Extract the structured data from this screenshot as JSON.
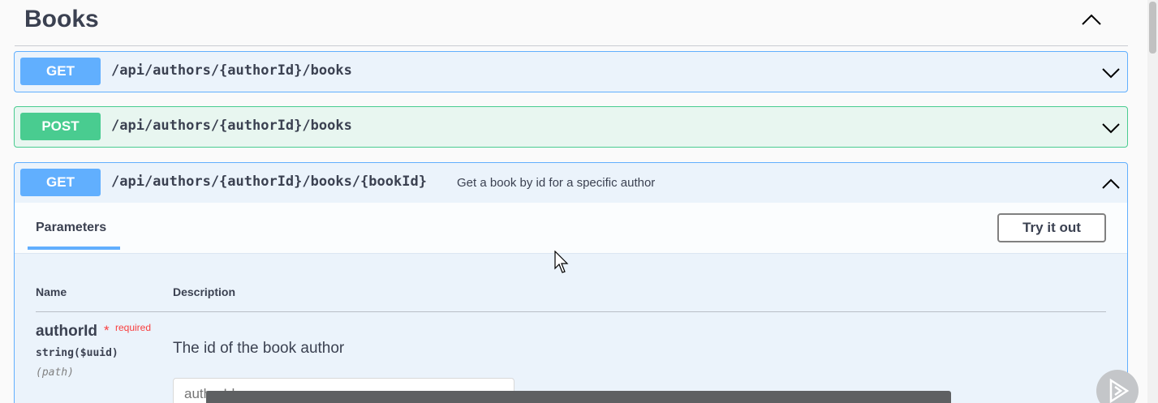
{
  "section": {
    "title": "Books"
  },
  "operations": [
    {
      "method": "GET",
      "path": "/api/authors/{authorId}/books"
    },
    {
      "method": "POST",
      "path": "/api/authors/{authorId}/books"
    },
    {
      "method": "GET",
      "path": "/api/authors/{authorId}/books/{bookId}",
      "summary": "Get a book by id for a specific author"
    }
  ],
  "expanded": {
    "tab_label": "Parameters",
    "try_button": "Try it out",
    "columns": {
      "name": "Name",
      "description": "Description"
    },
    "param": {
      "name": "authorId",
      "required_star": "*",
      "required_label": "required",
      "type": "string($uuid)",
      "in": "(path)",
      "description": "The id of the book author",
      "placeholder": "authorId"
    }
  },
  "colors": {
    "get": "#61affe",
    "post": "#49cc90",
    "required": "#f93e3e"
  },
  "icons": [
    "chevron-up-icon",
    "chevron-down-icon",
    "mouse-cursor-icon",
    "play-icon"
  ]
}
